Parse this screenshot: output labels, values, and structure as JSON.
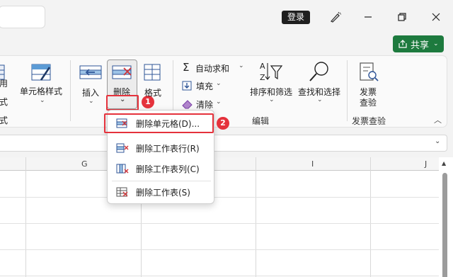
{
  "titlebar": {
    "login_label": "登录",
    "share_label": "共享"
  },
  "ribbon": {
    "cut_labels": [
      "用",
      "式",
      "式"
    ],
    "cell_styles_label": "单元格样式",
    "insert_label": "插入",
    "delete_label": "删除",
    "format_label": "格式",
    "autosum_label": "自动求和",
    "fill_label": "填充",
    "clear_label": "清除",
    "sort_filter_label": "排序和筛选",
    "find_select_label": "查找和选择",
    "invoice_label_1": "发票",
    "invoice_label_2": "查验",
    "group_editing": "编辑",
    "group_invoice": "发票查验"
  },
  "annotations": {
    "badge_1": "1",
    "badge_2": "2"
  },
  "grid": {
    "columns": [
      "G",
      "I",
      "J"
    ]
  },
  "delete_menu": {
    "items": [
      {
        "label": "删除单元格(D)..."
      },
      {
        "label": "删除工作表行(R)"
      },
      {
        "label": "删除工作表列(C)"
      },
      {
        "label": "删除工作表(S)"
      }
    ]
  },
  "colors": {
    "accent_green": "#1d7a3e",
    "annotation_red": "#e5323c"
  }
}
